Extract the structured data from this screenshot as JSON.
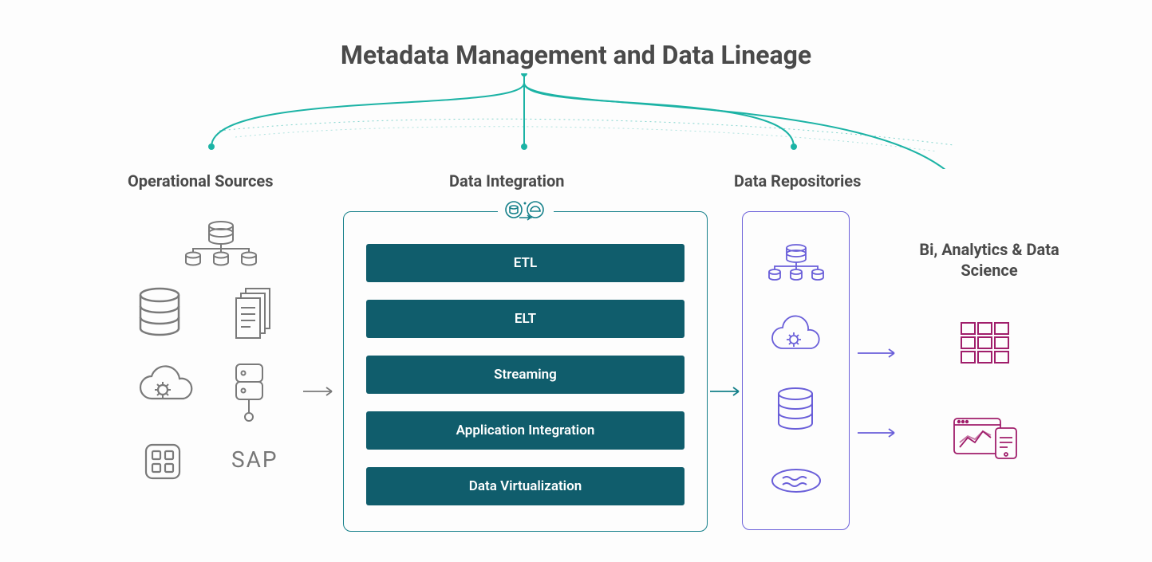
{
  "title": "Metadata Management and Data Lineage",
  "sections": {
    "operational": "Operational Sources",
    "integration": "Data Integration",
    "repositories": "Data Repositories",
    "analytics": "Bi, Analytics & Data Science"
  },
  "integration_steps": [
    "ETL",
    "ELT",
    "Streaming",
    "Application Integration",
    "Data Virtualization"
  ],
  "operational_icons": [
    "db-network",
    "database",
    "documents",
    "cloud-gear",
    "server-node",
    "app-grid",
    "SAP"
  ],
  "repository_icons": [
    "db-network",
    "cloud-gear",
    "database",
    "data-lake"
  ],
  "analytics_icons": [
    "grid-cubes",
    "dashboard-chart"
  ],
  "colors": {
    "teal": "#15808a",
    "teal_light": "#1cb3a5",
    "teal_dark": "#105d6c",
    "purple": "#6a5fd9",
    "magenta": "#a01e6b",
    "grey": "#7a7a7a"
  }
}
